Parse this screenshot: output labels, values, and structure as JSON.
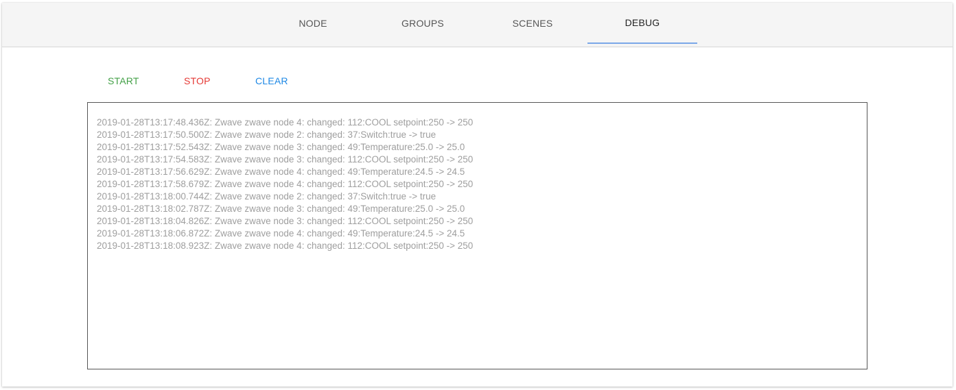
{
  "tabs": [
    {
      "label": "NODE",
      "active": false
    },
    {
      "label": "GROUPS",
      "active": false
    },
    {
      "label": "SCENES",
      "active": false
    },
    {
      "label": "DEBUG",
      "active": true
    }
  ],
  "actions": {
    "start_label": "START",
    "stop_label": "STOP",
    "clear_label": "CLEAR"
  },
  "colors": {
    "start": "#43a047",
    "stop": "#e53935",
    "clear": "#1e88e5",
    "tab_indicator": "#7aa7e8",
    "log_text": "#9e9e9e"
  },
  "log": [
    "2019-01-28T13:17:48.436Z: Zwave zwave node 4: changed: 112:COOL setpoint:250 -> 250",
    "2019-01-28T13:17:50.500Z: Zwave zwave node 2: changed: 37:Switch:true -> true",
    "2019-01-28T13:17:52.543Z: Zwave zwave node 3: changed: 49:Temperature:25.0 -> 25.0",
    "2019-01-28T13:17:54.583Z: Zwave zwave node 3: changed: 112:COOL setpoint:250 -> 250",
    "2019-01-28T13:17:56.629Z: Zwave zwave node 4: changed: 49:Temperature:24.5 -> 24.5",
    "2019-01-28T13:17:58.679Z: Zwave zwave node 4: changed: 112:COOL setpoint:250 -> 250",
    "2019-01-28T13:18:00.744Z: Zwave zwave node 2: changed: 37:Switch:true -> true",
    "2019-01-28T13:18:02.787Z: Zwave zwave node 3: changed: 49:Temperature:25.0 -> 25.0",
    "2019-01-28T13:18:04.826Z: Zwave zwave node 3: changed: 112:COOL setpoint:250 -> 250",
    "2019-01-28T13:18:06.872Z: Zwave zwave node 4: changed: 49:Temperature:24.5 -> 24.5",
    "2019-01-28T13:18:08.923Z: Zwave zwave node 4: changed: 112:COOL setpoint:250 -> 250"
  ]
}
